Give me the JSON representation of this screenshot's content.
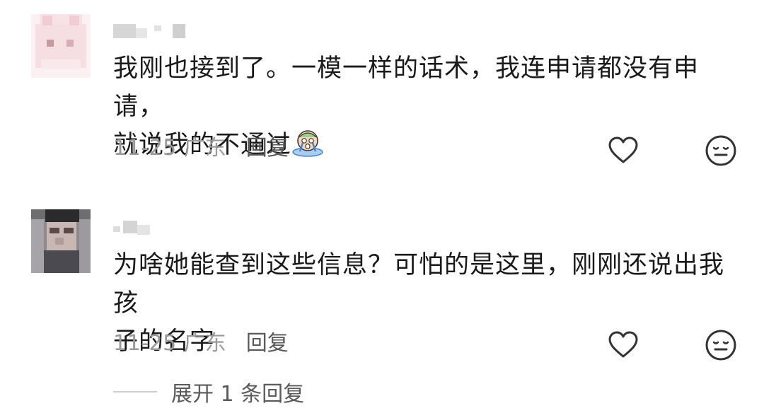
{
  "comments": [
    {
      "text_line1": "我刚也接到了。一模一样的话术，我连申请都没有申请，",
      "text_line2": "就说我的不通过",
      "emoji": "crying-emoji",
      "date": "11-25",
      "location": "广东",
      "reply_label": "回复"
    },
    {
      "text_line1": "为啥她能查到这些信息？可怕的是这里，刚刚还说出我孩",
      "text_line2": "子的名字",
      "date": "11-25",
      "location": "广东",
      "reply_label": "回复"
    }
  ],
  "expand_replies": {
    "label": "展开 1 条回复"
  },
  "icons": {
    "like": "heart-outline-icon",
    "dislike": "neutral-face-icon"
  },
  "colors": {
    "text": "#1a1a1a",
    "meta": "#9a9a9a",
    "reply": "#5a5a5a"
  }
}
